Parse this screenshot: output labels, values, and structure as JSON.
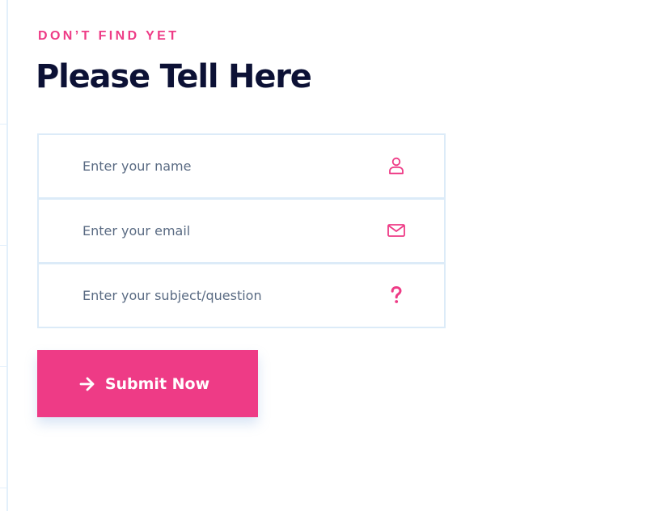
{
  "eyebrow": "DON’T FIND YET",
  "title": "Please Tell Here",
  "form": {
    "fields": [
      {
        "placeholder": "Enter your name",
        "icon": "user-icon"
      },
      {
        "placeholder": "Enter your email",
        "icon": "envelope-icon"
      },
      {
        "placeholder": "Enter your subject/question",
        "icon": "question-icon"
      }
    ],
    "submit_label": "Submit Now",
    "submit_icon": "arrow-right-icon"
  },
  "colors": {
    "accent": "#ee3b86",
    "heading": "#0c1135",
    "placeholder": "#5a6b83",
    "border": "#dcebf8"
  }
}
